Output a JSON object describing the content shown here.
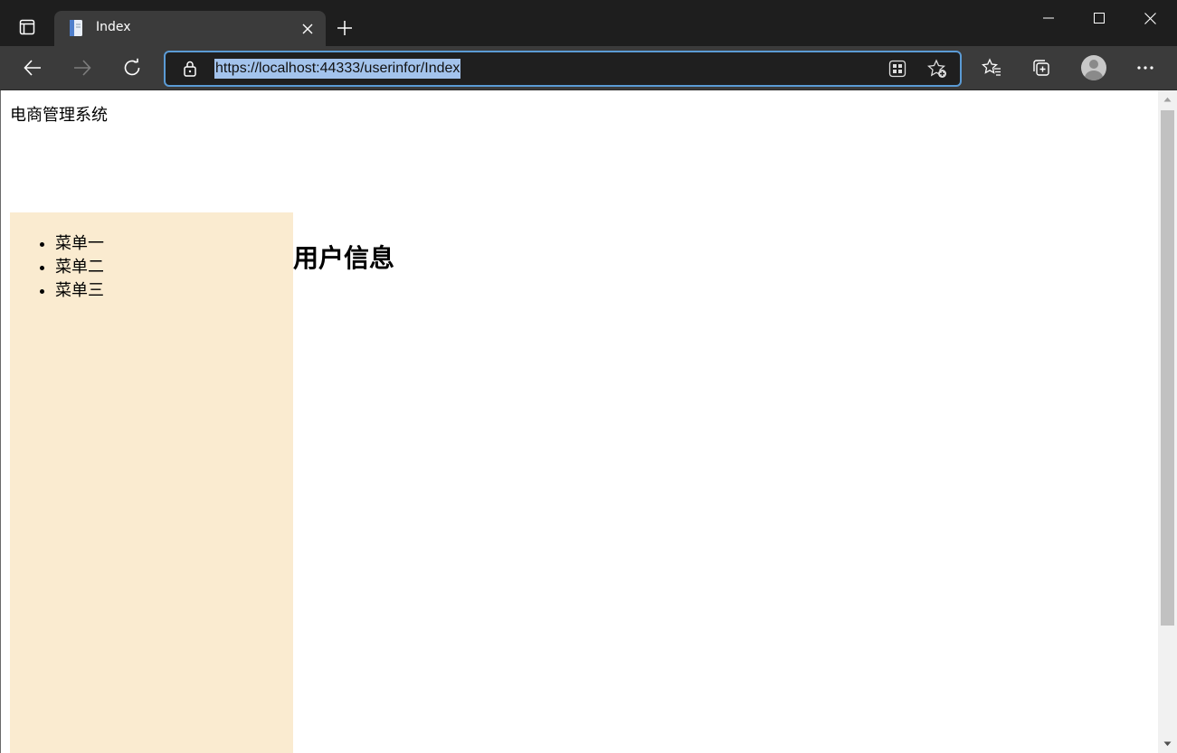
{
  "browser": {
    "tab": {
      "title": "Index"
    },
    "address": {
      "url": "https://localhost:44333/userinfor/Index"
    },
    "colors": {
      "titlebar": "#1e1e1e",
      "toolbar": "#3b3b3b",
      "url_highlight": "#a3c3ec",
      "focus_border": "#5b9bd5"
    }
  },
  "page": {
    "site_title": "电商管理系统",
    "heading": "用户信息",
    "menu": [
      {
        "label": "菜单一"
      },
      {
        "label": "菜单二"
      },
      {
        "label": "菜单三"
      }
    ],
    "colors": {
      "sidebar_bg": "#faebd0"
    }
  }
}
